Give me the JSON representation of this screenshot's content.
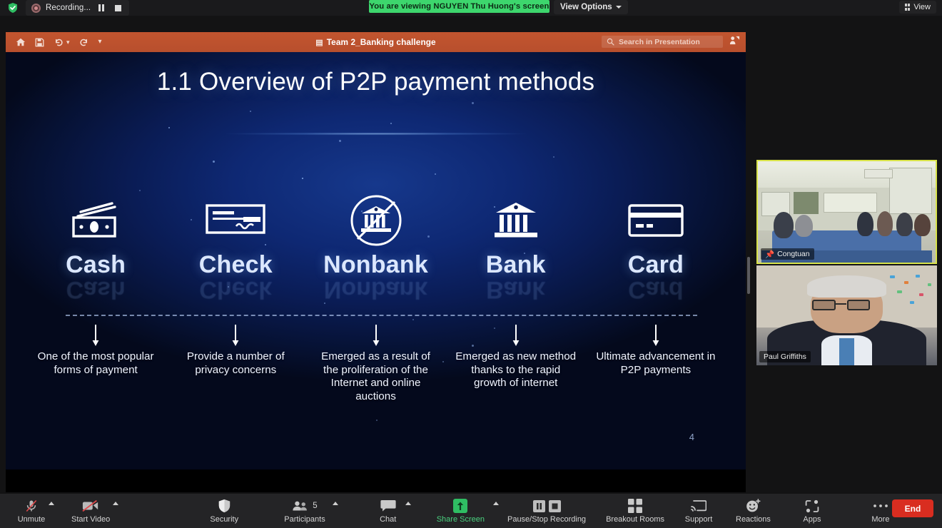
{
  "topbar": {
    "shield_icon": "shield-check-icon",
    "recording_label": "Recording...",
    "record_dot_icon": "record-dot-icon",
    "pause_icon": "pause-icon",
    "stop_icon": "stop-icon",
    "viewing_banner": "You are viewing NGUYEN Thu Huong's screen",
    "view_options_label": "View Options",
    "view_options_caret_icon": "chevron-down-icon",
    "view_label": "View",
    "view_grid_icon": "grid-layout-icon",
    "banner_color": "#3dd66d"
  },
  "presentation_toolbar": {
    "title": "Team 2_Banking challenge",
    "doc_icon": "document-icon",
    "home_icon": "home-icon",
    "save_icon": "save-icon",
    "undo_icon": "undo-icon",
    "undo_caret_icon": "chevron-down-icon",
    "redo_icon": "redo-icon",
    "more_caret_icon": "chevron-down-icon",
    "search_placeholder": "Search in Presentation",
    "search_icon": "search-icon",
    "share_icon": "person-share-icon",
    "bar_color": "#b84f2d"
  },
  "slide": {
    "title": "1.1 Overview of P2P payment methods",
    "page_number": "4",
    "columns": [
      {
        "label": "Cash",
        "icon": "banknotes-icon",
        "arrow_icon": "down-arrow-icon",
        "description": "One of the most popular forms of payment"
      },
      {
        "label": "Check",
        "icon": "cheque-icon",
        "arrow_icon": "down-arrow-icon",
        "description": "Provide a number of privacy concerns"
      },
      {
        "label": "Nonbank",
        "icon": "bank-crossed-out-icon",
        "arrow_icon": "down-arrow-icon",
        "description": "Emerged as a result of the proliferation of the Internet and online auctions"
      },
      {
        "label": "Bank",
        "icon": "bank-building-icon",
        "arrow_icon": "down-arrow-icon",
        "description": "Emerged as new method  thanks to the rapid growth of internet"
      },
      {
        "label": "Card",
        "icon": "credit-card-icon",
        "arrow_icon": "down-arrow-icon",
        "description": "Ultimate advancement in P2P payments"
      }
    ]
  },
  "video_tiles": [
    {
      "name": "Congtuan",
      "pin_icon": "pin-icon",
      "highlighted": true
    },
    {
      "name": "Paul Griffiths",
      "pin_icon": "",
      "highlighted": false
    }
  ],
  "bottom_toolbar": {
    "items": [
      {
        "label": "Unmute",
        "icon": "microphone-muted-icon",
        "caret": true,
        "badge": ""
      },
      {
        "label": "Start Video",
        "icon": "video-off-icon",
        "caret": true,
        "badge": ""
      },
      {
        "label": "Security",
        "icon": "shield-icon",
        "caret": false,
        "badge": ""
      },
      {
        "label": "Participants",
        "icon": "participants-icon",
        "caret": true,
        "badge": "5"
      },
      {
        "label": "Chat",
        "icon": "chat-bubble-icon",
        "caret": true,
        "badge": ""
      },
      {
        "label": "Share Screen",
        "icon": "share-screen-icon",
        "caret": true,
        "badge": ""
      },
      {
        "label": "Pause/Stop Recording",
        "icon": "pause-stop-icon",
        "caret": false,
        "badge": ""
      },
      {
        "label": "Breakout Rooms",
        "icon": "breakout-grid-icon",
        "caret": false,
        "badge": ""
      },
      {
        "label": "Support",
        "icon": "support-cast-icon",
        "caret": false,
        "badge": ""
      },
      {
        "label": "Reactions",
        "icon": "reactions-smiley-icon",
        "caret": false,
        "badge": ""
      },
      {
        "label": "Apps",
        "icon": "apps-icon",
        "caret": false,
        "badge": ""
      },
      {
        "label": "More",
        "icon": "more-dots-icon",
        "caret": false,
        "badge": ""
      }
    ],
    "end_label": "End",
    "end_color": "#d92d20",
    "share_active_color": "#4ad17f"
  }
}
